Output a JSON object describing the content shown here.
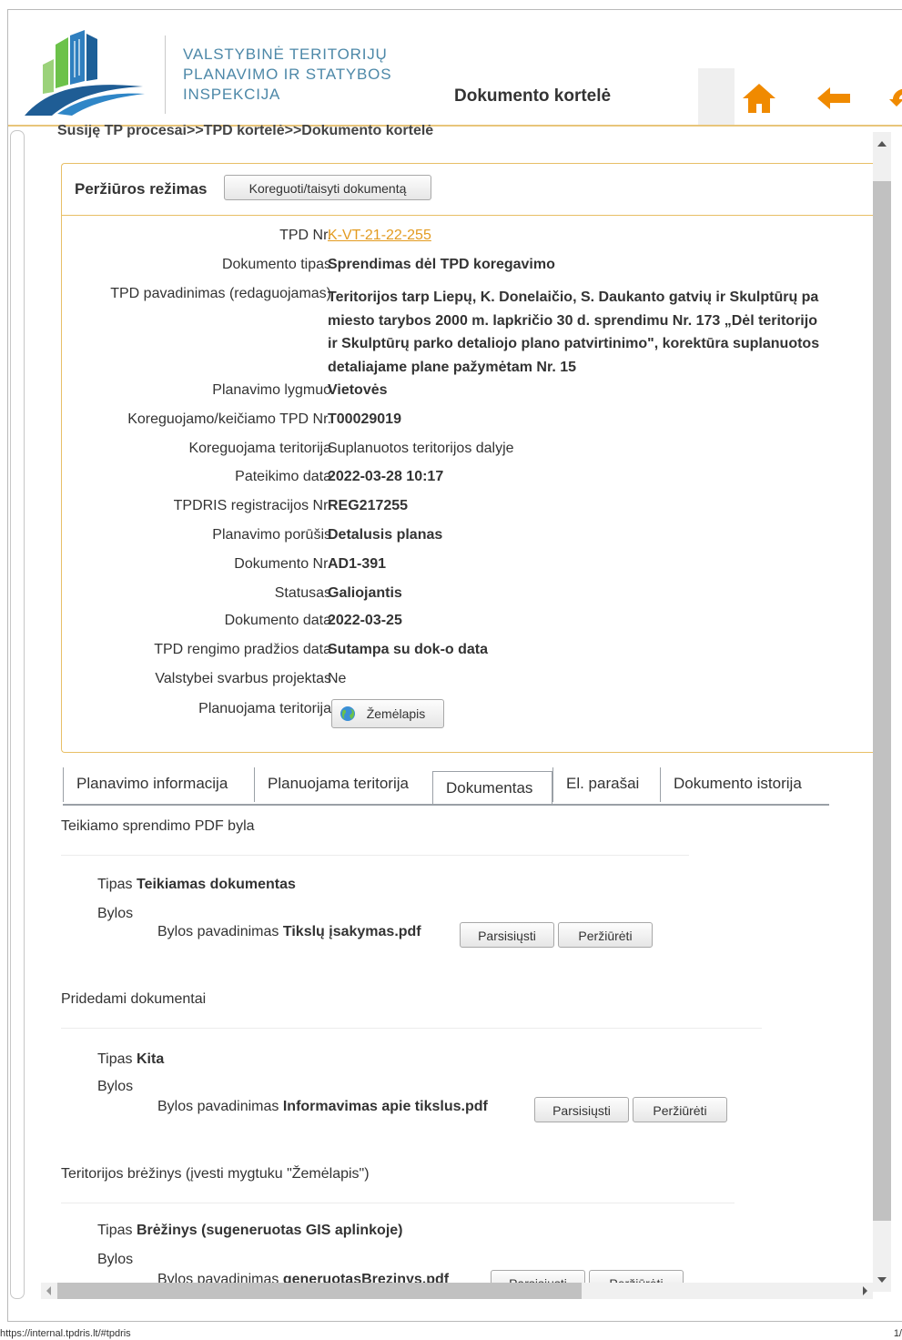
{
  "header": {
    "org_line1": "VALSTYBINĖ TERITORIJŲ",
    "org_line2": "PLANAVIMO IR STATYBOS",
    "org_line3": "INSPEKCIJA",
    "page_title": "Dokumento kortelė",
    "nav_icons": [
      "home-icon",
      "back-arrow-icon",
      "refresh-icon"
    ],
    "accent_color": "#f08a00"
  },
  "breadcrumb": "Susiję TP procesai>>TPD kortelė>>Dokumento kortelė",
  "card": {
    "mode_label": "Peržiūros režimas",
    "edit_button": "Koreguoti/taisyti dokumentą",
    "fields": {
      "tpd_nr_label": "TPD Nr.",
      "tpd_nr_value": "K-VT-21-22-255",
      "doc_type_label": "Dokumento tipas",
      "doc_type_value": "Sprendimas dėl TPD koregavimo",
      "tpd_name_label": "TPD pavadinimas (redaguojamas)",
      "tpd_name_line1": "Teritorijos tarp Liepų, K. Donelaičio, S. Daukanto gatvių ir Skulptūrų pa",
      "tpd_name_line2": "miesto tarybos 2000 m. lapkričio 30 d. sprendimu Nr. 173 „Dėl teritorijo",
      "tpd_name_line3": "ir Skulptūrų parko detaliojo plano patvirtinimo\", korektūra suplanuotos",
      "tpd_name_line4": "detaliajame plane pažymėtam Nr. 15",
      "level_label": "Planavimo lygmuo",
      "level_value": "Vietovės",
      "corrected_nr_label": "Koreguojamo/keičiamo TPD Nr.",
      "corrected_nr_value": "T00029019",
      "corrected_area_label": "Koreguojama teritorija",
      "corrected_area_value": "Suplanuotos teritorijos dalyje",
      "submit_date_label": "Pateikimo data",
      "submit_date_value": "2022-03-28 10:17",
      "reg_nr_label": "TPDRIS registracijos Nr.",
      "reg_nr_value": "REG217255",
      "subtype_label": "Planavimo porūšis",
      "subtype_value": "Detalusis planas",
      "doc_nr_label": "Dokumento Nr.",
      "doc_nr_value": "AD1-391",
      "status_label": "Statusas",
      "status_value": "Galiojantis",
      "doc_date_label": "Dokumento data",
      "doc_date_value": "2022-03-25",
      "start_date_label": "TPD rengimo pradžios data",
      "start_date_value": "Sutampa su dok-o data",
      "state_label": "Valstybei svarbus projektas",
      "state_value": "Ne",
      "territory_label": "Planuojama teritorija",
      "map_button": "Žemėlapis"
    }
  },
  "tabs": [
    "Planavimo informacija",
    "Planuojama teritorija",
    "Dokumentas",
    "El. parašai",
    "Dokumento istorija"
  ],
  "active_tab": "Dokumentas",
  "documents": {
    "type_label": "Tipas",
    "files_label": "Bylos",
    "file_name_label": "Bylos pavadinimas",
    "download_button": "Parsisiųsti",
    "view_button": "Peržiūrėti",
    "sections": [
      {
        "title": "Teikiamo sprendimo PDF byla",
        "type": "Teikiamas dokumentas",
        "file": "Tikslų įsakymas.pdf"
      },
      {
        "title": "Pridedami dokumentai",
        "type": "Kita",
        "file": "Informavimas apie tikslus.pdf"
      },
      {
        "title": "Teritorijos brėžinys (įvesti mygtuku \"Žemėlapis\")",
        "type": "Brėžinys (sugeneruotas GIS aplinkoje)",
        "file": "generuotasBrezinys.pdf"
      }
    ]
  },
  "statusbar": {
    "url": "https://internal.tpdris.lt/#tpdris",
    "page": "1/"
  }
}
